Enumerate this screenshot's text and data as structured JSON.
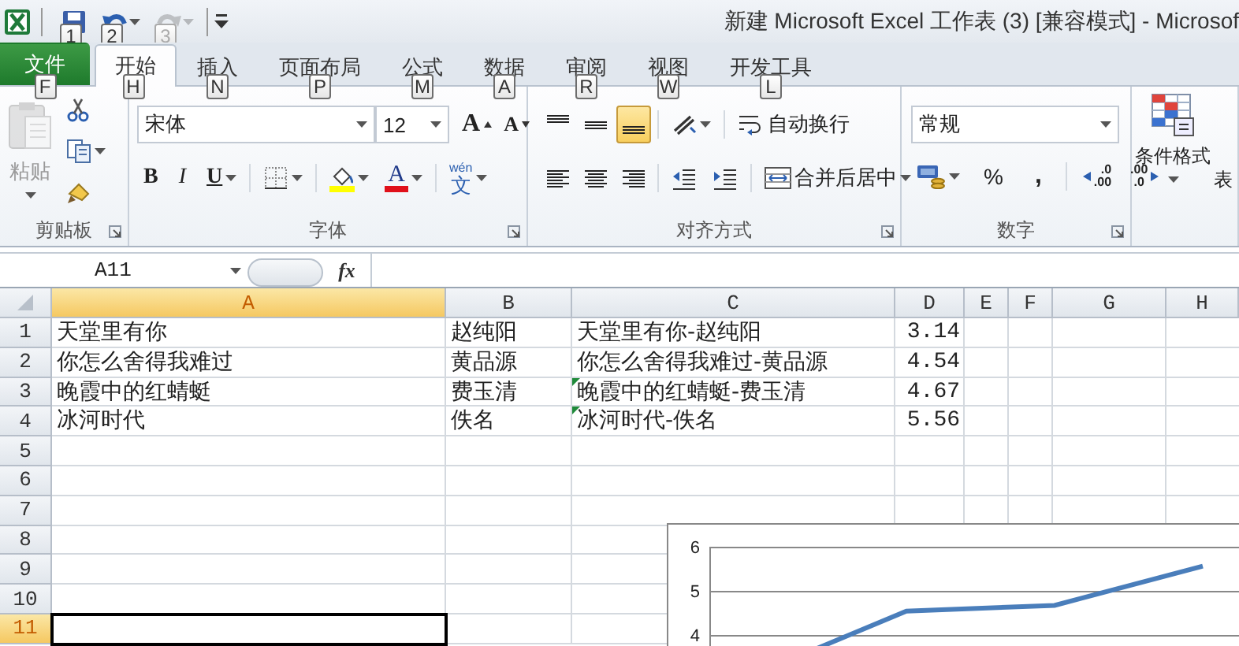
{
  "window": {
    "title": "新建 Microsoft Excel 工作表 (3)  [兼容模式] - Microsof"
  },
  "quick_access": [
    {
      "kind": "save",
      "keytip": "1",
      "disabled": false
    },
    {
      "kind": "undo",
      "keytip": "2",
      "disabled": false
    },
    {
      "kind": "redo",
      "keytip": "3",
      "disabled": true
    }
  ],
  "tabs": [
    {
      "kind": "file",
      "label": "文件",
      "keytip": "F",
      "selected": false
    },
    {
      "kind": "tab",
      "label": "开始",
      "keytip": "H",
      "selected": true
    },
    {
      "kind": "tab",
      "label": "插入",
      "keytip": "N",
      "selected": false
    },
    {
      "kind": "tab",
      "label": "页面布局",
      "keytip": "P",
      "selected": false
    },
    {
      "kind": "tab",
      "label": "公式",
      "keytip": "M",
      "selected": false
    },
    {
      "kind": "tab",
      "label": "数据",
      "keytip": "A",
      "selected": false
    },
    {
      "kind": "tab",
      "label": "审阅",
      "keytip": "R",
      "selected": false
    },
    {
      "kind": "tab",
      "label": "视图",
      "keytip": "W",
      "selected": false
    },
    {
      "kind": "tab",
      "label": "开发工具",
      "keytip": "L",
      "selected": false
    }
  ],
  "clipboard": {
    "paste": "粘贴",
    "paste_disabled": true,
    "group_label": "剪贴板"
  },
  "font": {
    "name": "宋体",
    "size": "12",
    "grow": "A",
    "shrink": "A",
    "bold": "B",
    "italic": "I",
    "underline": "U",
    "font_color": "A",
    "phonetic_ruby": "wén",
    "phonetic_char": "文",
    "group_label": "字体"
  },
  "alignment": {
    "buttons": [
      {
        "kind": "top",
        "selected": false
      },
      {
        "kind": "middle",
        "selected": false
      },
      {
        "kind": "bottom",
        "selected": true
      },
      {
        "kind": "left",
        "selected": false
      },
      {
        "kind": "center",
        "selected": false
      },
      {
        "kind": "right",
        "selected": false
      }
    ],
    "wrap_text": "自动换行",
    "merge_center": "合并后居中",
    "group_label": "对齐方式"
  },
  "number": {
    "format": "常规",
    "percent": "%",
    "comma": ",",
    "increase_decimal": [
      ".0",
      ".00"
    ],
    "decrease_decimal": [
      ".00",
      ".0"
    ],
    "group_label": "数字"
  },
  "styles": {
    "conditional_format": "条件格式",
    "next_label": "表"
  },
  "formula_bar": {
    "name_box": "A11",
    "fx": "fx"
  },
  "sheet": {
    "columns": [
      {
        "label": "A",
        "selected": true
      },
      {
        "label": "B",
        "selected": false
      },
      {
        "label": "C",
        "selected": false
      },
      {
        "label": "D",
        "selected": false
      },
      {
        "label": "E",
        "selected": false
      },
      {
        "label": "F",
        "selected": false
      },
      {
        "label": "G",
        "selected": false
      },
      {
        "label": "H",
        "selected": false
      }
    ],
    "rows": [
      {
        "header": "1",
        "selected": false,
        "error_marker": false,
        "cells": [
          "天堂里有你",
          "赵纯阳",
          "天堂里有你-赵纯阳",
          "3.14"
        ]
      },
      {
        "header": "2",
        "selected": false,
        "error_marker": false,
        "cells": [
          "你怎么舍得我难过",
          "黄品源",
          "你怎么舍得我难过-黄品源",
          "4.54"
        ]
      },
      {
        "header": "3",
        "selected": false,
        "error_marker": true,
        "cells": [
          "晚霞中的红蜻蜓",
          "费玉清",
          "晚霞中的红蜻蜓-费玉清",
          "4.67"
        ]
      },
      {
        "header": "4",
        "selected": false,
        "error_marker": true,
        "cells": [
          "冰河时代",
          "佚名",
          "冰河时代-佚名",
          "5.56"
        ]
      },
      {
        "header": "5",
        "selected": false
      },
      {
        "header": "6",
        "selected": false
      },
      {
        "header": "7",
        "selected": false
      },
      {
        "header": "8",
        "selected": false
      },
      {
        "header": "9",
        "selected": false
      },
      {
        "header": "10",
        "selected": false
      },
      {
        "header": "11",
        "selected": true
      }
    ]
  },
  "chart": {
    "chart_data": {
      "type": "line",
      "values": [
        3.14,
        4.54,
        4.67,
        5.56
      ],
      "ylim": [
        3,
        6
      ],
      "yticks": [
        4,
        5,
        6
      ]
    }
  }
}
